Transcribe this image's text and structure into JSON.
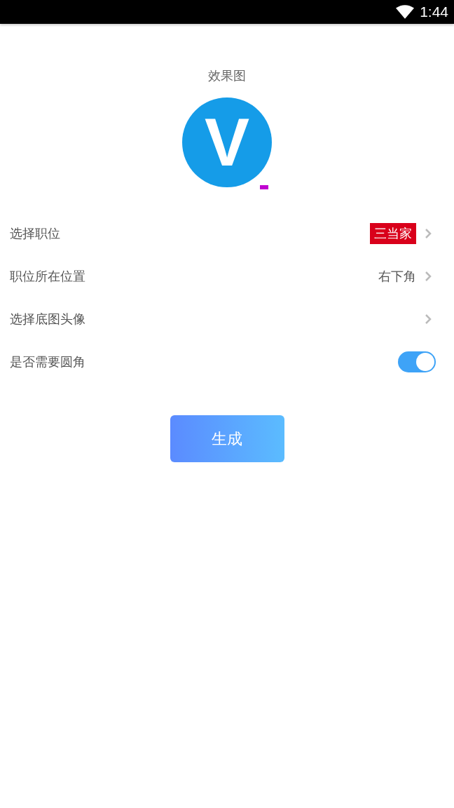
{
  "status_bar": {
    "time": "1:44"
  },
  "preview": {
    "title": "效果图",
    "logo_letter": "V"
  },
  "rows": [
    {
      "kind": "badge",
      "label": "选择职位",
      "value": "三当家"
    },
    {
      "kind": "value",
      "label": "职位所在位置",
      "value": "右下角"
    },
    {
      "kind": "link",
      "label": "选择底图头像"
    },
    {
      "kind": "toggle",
      "label": "是否需要圆角",
      "on": true
    }
  ],
  "generate_button": "生成"
}
